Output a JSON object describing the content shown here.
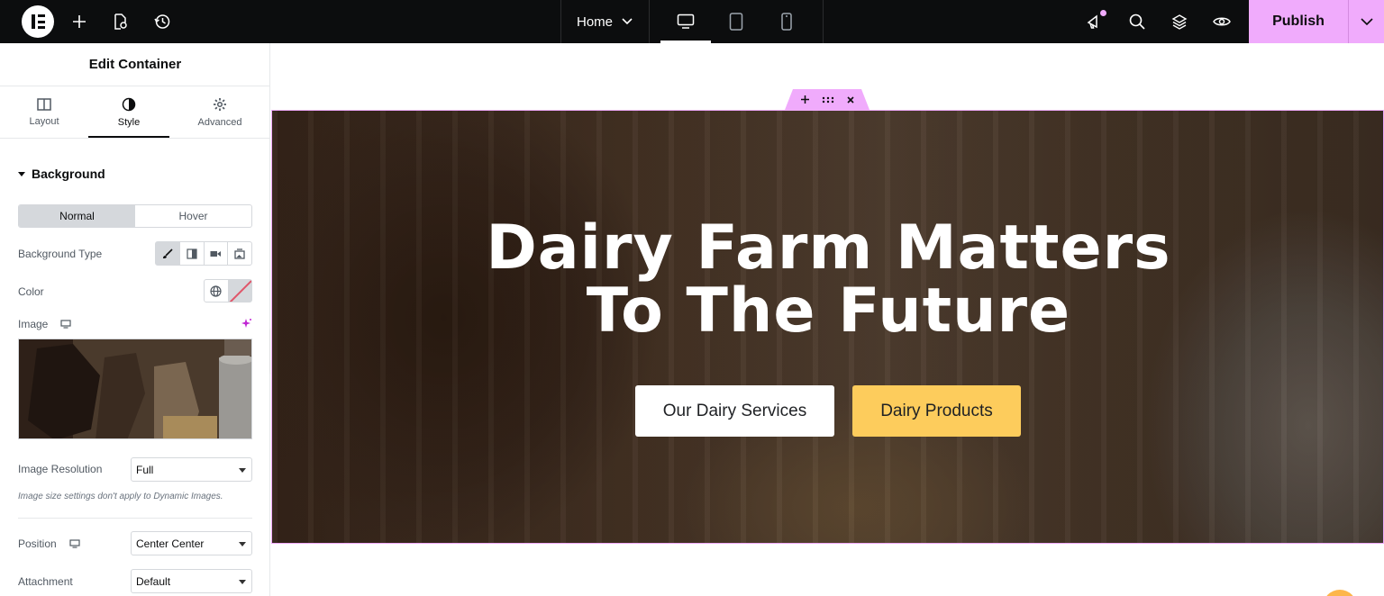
{
  "topbar": {
    "page_selector": "Home",
    "publish_label": "Publish",
    "icons": [
      "elementor-logo-icon",
      "add-icon",
      "page-settings-icon",
      "history-icon",
      "chevron-down-icon",
      "desktop-icon",
      "tablet-icon",
      "mobile-icon",
      "announcements-icon",
      "search-icon",
      "structure-icon",
      "preview-icon"
    ],
    "accent_color": "#f0abfc"
  },
  "panel": {
    "title": "Edit Container",
    "tabs": [
      {
        "label": "Layout"
      },
      {
        "label": "Style"
      },
      {
        "label": "Advanced"
      }
    ],
    "active_tab": "Style",
    "section_title": "Background",
    "state_toggle": {
      "normal": "Normal",
      "hover": "Hover",
      "active": "Normal"
    },
    "bg_type_label": "Background Type",
    "color_label": "Color",
    "image_label": "Image",
    "image_resolution": {
      "label": "Image Resolution",
      "value": "Full"
    },
    "dynamic_note": "Image size settings don't apply to Dynamic Images.",
    "position": {
      "label": "Position",
      "value": "Center Center"
    },
    "attachment": {
      "label": "Attachment",
      "value": "Default"
    }
  },
  "canvas": {
    "hero_title_line1": "Dairy Farm Matters",
    "hero_title_line2": "To The Future",
    "button_primary": "Our Dairy Services",
    "button_secondary": "Dairy Products",
    "button_secondary_color": "#fdcc5c"
  }
}
